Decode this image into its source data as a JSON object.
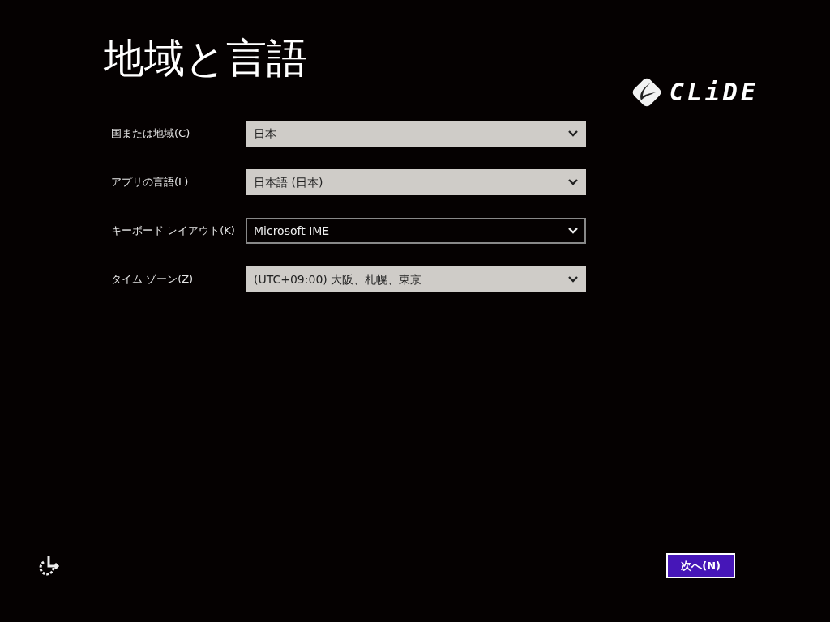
{
  "title": "地域と言語",
  "logo": {
    "text": "CLiDE"
  },
  "fields": [
    {
      "label": "国または地域(C)",
      "value": "日本",
      "focused": false
    },
    {
      "label": "アプリの言語(L)",
      "value": "日本語 (日本)",
      "focused": false
    },
    {
      "label": "キーボード レイアウト(K)",
      "value": "Microsoft IME",
      "focused": true
    },
    {
      "label": "タイム ゾーン(Z)",
      "value": "(UTC+09:00) 大阪、札幌、東京",
      "focused": false
    }
  ],
  "next_button": "次へ(N)"
}
